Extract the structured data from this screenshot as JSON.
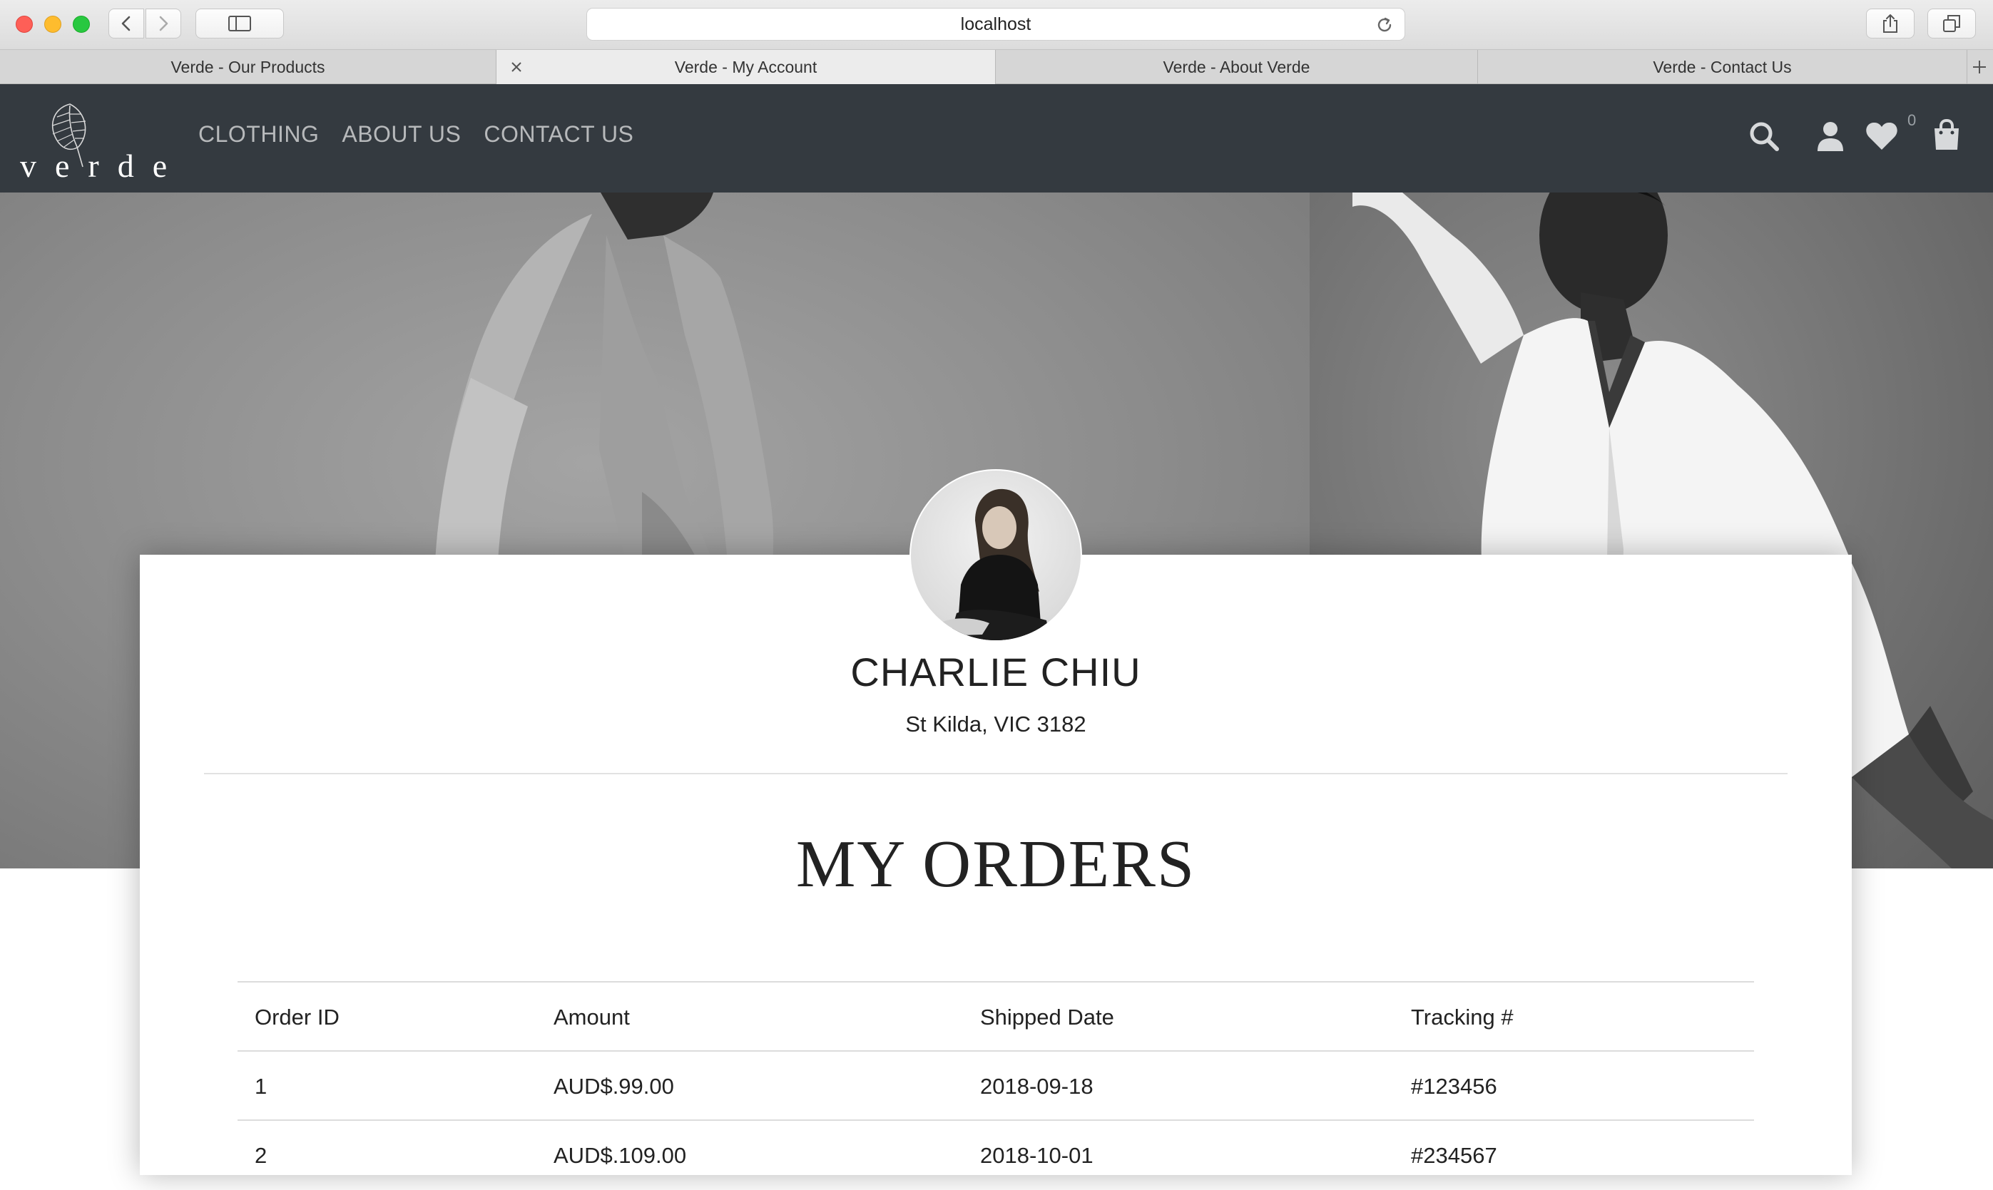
{
  "browser": {
    "url": "localhost",
    "tabs": [
      {
        "label": "Verde - Our Products",
        "active": false
      },
      {
        "label": "Verde - My Account",
        "active": true
      },
      {
        "label": "Verde - About Verde",
        "active": false
      },
      {
        "label": "Verde - Contact Us",
        "active": false
      }
    ],
    "icons": [
      "back-icon",
      "forward-icon",
      "sidebar-icon",
      "reload-icon",
      "share-icon",
      "tabs-overview-icon",
      "tab-close-icon",
      "new-tab-icon"
    ]
  },
  "site": {
    "logo_text": "verde",
    "nav": [
      "CLOTHING",
      "ABOUT US",
      "CONTACT US"
    ],
    "cart_count": "0",
    "icons": [
      "search-icon",
      "account-icon",
      "wishlist-heart-icon",
      "shopping-bag-icon"
    ]
  },
  "profile": {
    "name": "CHARLIE CHIU",
    "location": "St Kilda, VIC 3182"
  },
  "orders": {
    "title": "MY ORDERS",
    "headers": [
      "Order ID",
      "Amount",
      "Shipped Date",
      "Tracking #"
    ],
    "rows": [
      [
        "1",
        "AUD$.99.00",
        "2018-09-18",
        "#123456"
      ],
      [
        "2",
        "AUD$.109.00",
        "2018-10-01",
        "#234567"
      ]
    ]
  },
  "colors": {
    "nav_bg": "#343a40",
    "nav_link": "#b7b9bb",
    "text": "#222222"
  }
}
